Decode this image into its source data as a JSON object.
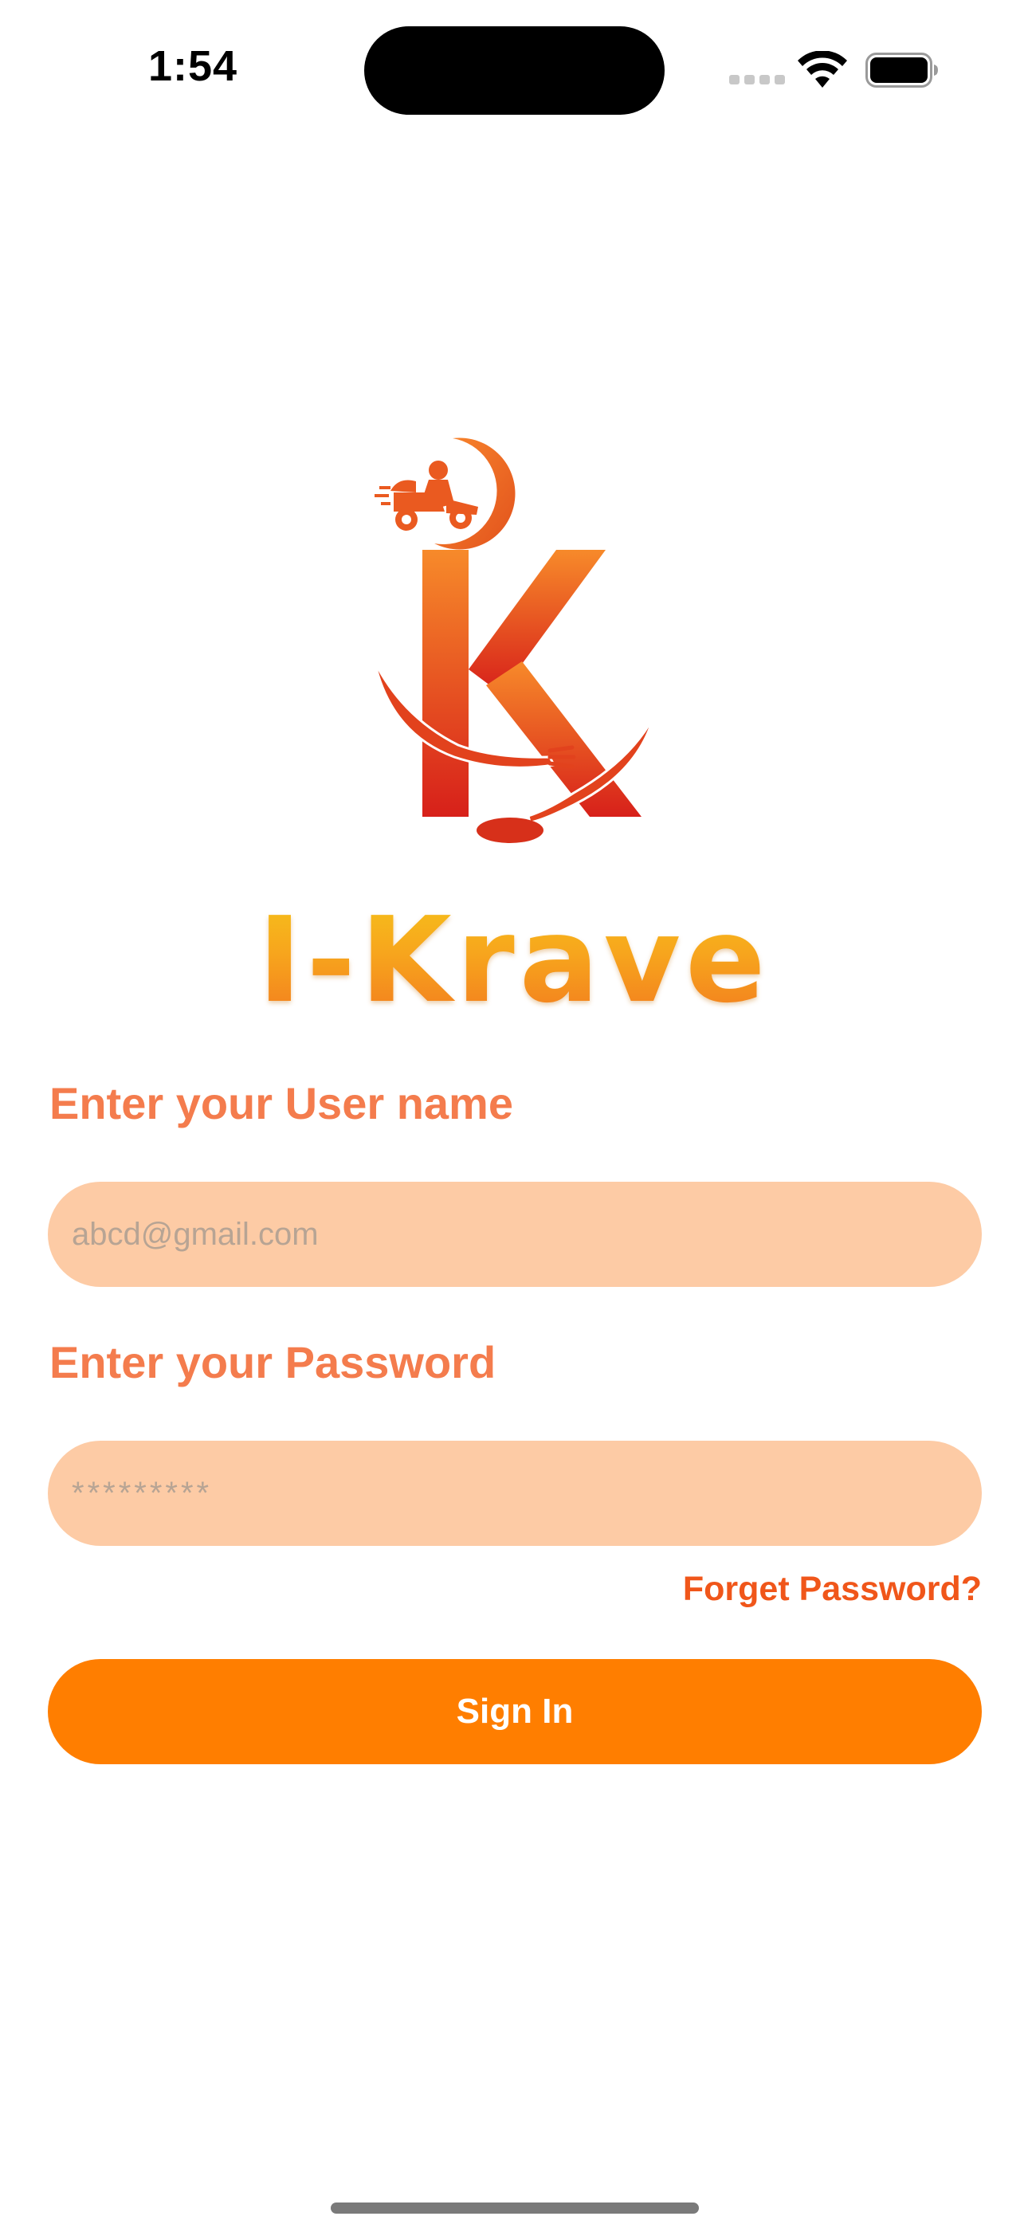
{
  "status_bar": {
    "time": "1:54"
  },
  "brand": {
    "name": "I-Krave"
  },
  "form": {
    "username_label": "Enter your User name",
    "username_placeholder": "abcd@gmail.com",
    "password_label": "Enter your Password",
    "password_placeholder": "*********",
    "forget_password_label": "Forget Password?",
    "sign_in_label": "Sign In"
  },
  "colors": {
    "accent": "#ff7e00",
    "label": "#f47c4d",
    "input_background": "#fdcba5",
    "link": "#f0561a"
  },
  "icons": [
    "signal-icon",
    "wifi-icon",
    "battery-icon",
    "logo-icon"
  ]
}
